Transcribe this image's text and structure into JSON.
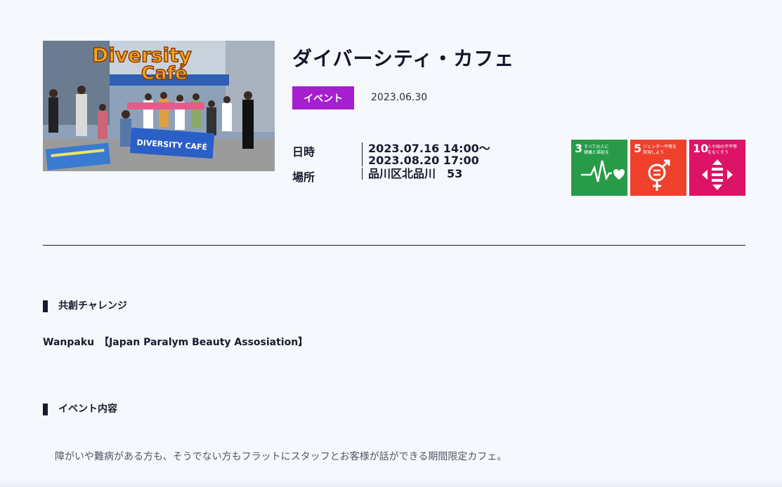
{
  "article": {
    "title": "ダイバーシティ・カフェ",
    "category": "イベント",
    "posted_date": "2023.06.30",
    "photo": {
      "logo_line1": "Diversity",
      "logo_line2": "Café",
      "banner_text": "DIVERSITY CAFÉ"
    },
    "details": {
      "datetime_label": "日時",
      "datetime_line1": "2023.07.16 14:00〜",
      "datetime_line2": "2023.08.20 17:00",
      "location_label": "場所",
      "location_value": "品川区北品川　53"
    },
    "sdgs": [
      {
        "number": "3",
        "text_line1": "すべての人に",
        "text_line2": "健康と福祉を",
        "color": "#279b48",
        "icon": "heartbeat-icon"
      },
      {
        "number": "5",
        "text_line1": "ジェンダー平等を",
        "text_line2": "実現しよう",
        "color": "#ef402b",
        "icon": "gender-equality-icon"
      },
      {
        "number": "10",
        "text_line1": "人や国の不平等",
        "text_line2": "をなくそう",
        "color": "#dd1367",
        "icon": "reduced-inequalities-icon"
      }
    ],
    "challenge": {
      "heading": "共創チャレンジ",
      "text": "Wanpaku　【Japan Paralym Beauty Assosiation】"
    },
    "event_content": {
      "heading": "イベント内容",
      "text": "障がいや難病がある方も、そうでない方もフラットにスタッフとお客様が話ができる期間限定カフェ。"
    }
  }
}
